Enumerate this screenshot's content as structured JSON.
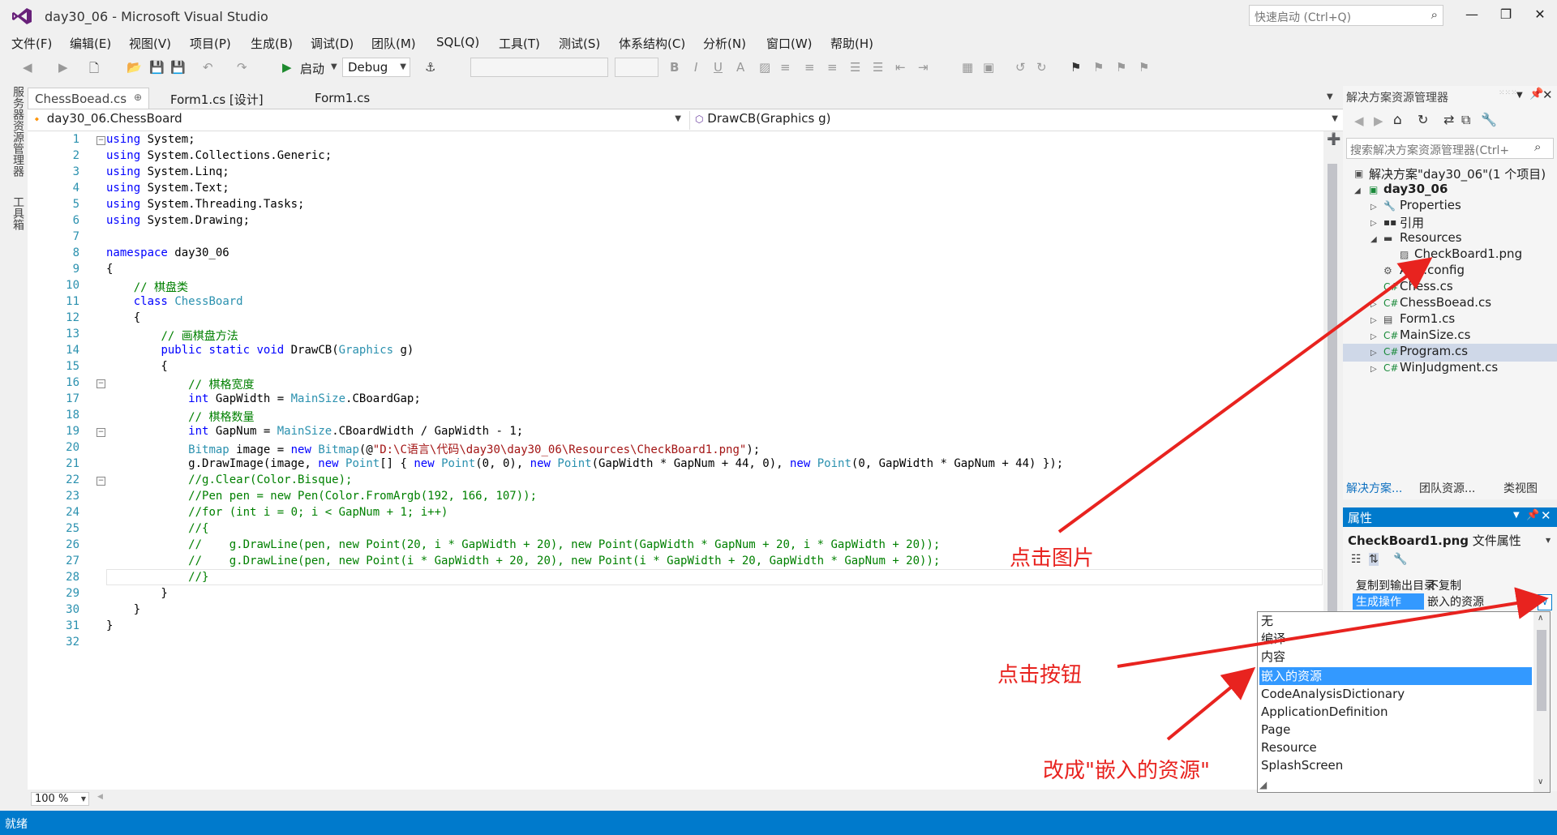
{
  "window": {
    "title": "day30_06 - Microsoft Visual Studio",
    "quick_launch_placeholder": "快速启动 (Ctrl+Q)",
    "minimize": "—",
    "restore": "❐",
    "close": "✕"
  },
  "menu": [
    "文件(F)",
    "编辑(E)",
    "视图(V)",
    "项目(P)",
    "生成(B)",
    "调试(D)",
    "团队(M)",
    "SQL(Q)",
    "工具(T)",
    "测试(S)",
    "体系结构(C)",
    "分析(N)",
    "窗口(W)",
    "帮助(H)"
  ],
  "toolbar": {
    "start_label": "启动",
    "config_value": "Debug"
  },
  "left_strip": {
    "server_explorer": "服务器资源管理器",
    "toolbox": "工具箱"
  },
  "tabs": [
    "ChessBoead.cs",
    "Form1.cs [设计]",
    "Form1.cs"
  ],
  "tab_pin": "⊕",
  "tab_close": "✕",
  "nav": {
    "class_value": "day30_06.ChessBoard",
    "member_value": "DrawCB(Graphics g)"
  },
  "code_lines": [
    "using System;",
    "using System.Collections.Generic;",
    "using System.Linq;",
    "using System.Text;",
    "using System.Threading.Tasks;",
    "using System.Drawing;",
    "",
    "namespace day30_06",
    "{",
    "    // 棋盘类",
    "    class ChessBoard",
    "    {",
    "        // 画棋盘方法",
    "        public static void DrawCB(Graphics g)",
    "        {",
    "            // 棋格宽度",
    "            int GapWidth = MainSize.CBoardGap;",
    "            // 棋格数量",
    "            int GapNum = MainSize.CBoardWidth / GapWidth - 1;",
    "            Bitmap image = new Bitmap(@\"D:\\C语言\\代码\\day30\\day30_06\\Resources\\CheckBoard1.png\");",
    "            g.DrawImage(image, new Point[] { new Point(0, 0), new Point(GapWidth * GapNum + 44, 0), new Point(0, GapWidth * GapNum + 44) });",
    "            //g.Clear(Color.Bisque);",
    "            //Pen pen = new Pen(Color.FromArgb(192, 166, 107));",
    "            //for (int i = 0; i < GapNum + 1; i++)",
    "            //{",
    "            //    g.DrawLine(pen, new Point(20, i * GapWidth + 20), new Point(GapWidth * GapNum + 20, i * GapWidth + 20));",
    "            //    g.DrawLine(pen, new Point(i * GapWidth + 20, 20), new Point(i * GapWidth + 20, GapWidth * GapNum + 20));",
    "            //}",
    "        }",
    "    }",
    "}",
    ""
  ],
  "zoom": "100 %",
  "solution_explorer": {
    "title": "解决方案资源管理器",
    "search_placeholder": "搜索解决方案资源管理器(Ctrl+",
    "solution": "解决方案\"day30_06\"(1 个项目)",
    "project": "day30_06",
    "items": [
      "Properties",
      "引用",
      "Resources",
      "CheckBoard1.png",
      "App.config",
      "Chess.cs",
      "ChessBoead.cs",
      "Form1.cs",
      "MainSize.cs",
      "Program.cs",
      "WinJudgment.cs"
    ],
    "bottom_tabs": [
      "解决方案...",
      "团队资源...",
      "类视图"
    ]
  },
  "properties": {
    "title": "属性",
    "object": "CheckBoard1.png",
    "object_type": "文件属性",
    "copy_label": "复制到输出目录",
    "copy_value": "不复制",
    "build_label": "生成操作",
    "build_value": "嵌入的资源",
    "options": [
      "无",
      "编译",
      "内容",
      "嵌入的资源",
      "CodeAnalysisDictionary",
      "ApplicationDefinition",
      "Page",
      "Resource",
      "SplashScreen"
    ]
  },
  "status": "就绪",
  "annotations": [
    "点击图片",
    "点击按钮",
    "改成\"嵌入的资源\""
  ],
  "colors": {
    "accent": "#007acc",
    "annotation": "#e8231f",
    "keyword": "#0000ff",
    "type": "#2b91af",
    "comment": "#008000",
    "string": "#a31515"
  }
}
